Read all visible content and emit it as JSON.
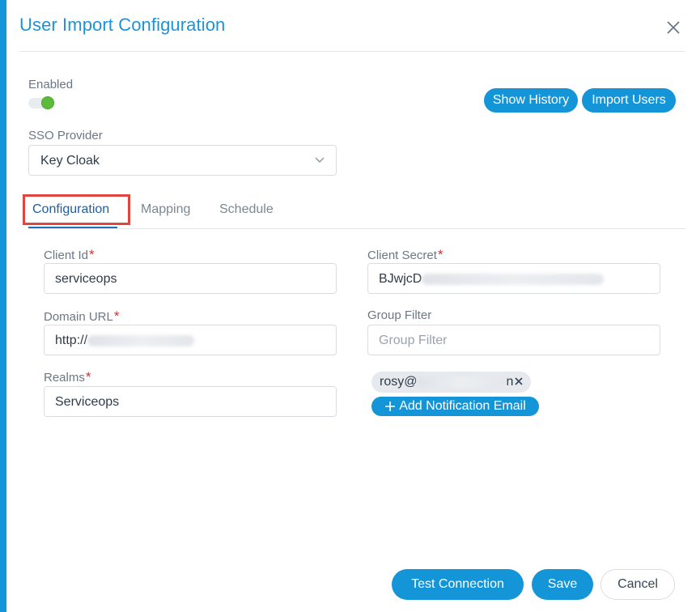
{
  "dialog": {
    "title": "User Import Configuration"
  },
  "enabled": {
    "label": "Enabled",
    "on": true
  },
  "header_actions": {
    "show_history": "Show History",
    "import_users": "Import Users"
  },
  "sso": {
    "label": "SSO Provider",
    "value": "Key Cloak"
  },
  "tabs": [
    {
      "label": "Configuration",
      "active": true
    },
    {
      "label": "Mapping",
      "active": false
    },
    {
      "label": "Schedule",
      "active": false
    }
  ],
  "form": {
    "client_id": {
      "label": "Client Id",
      "required": "*",
      "value": "serviceops"
    },
    "client_secret": {
      "label": "Client Secret",
      "required": "*",
      "value": "BJwjcD"
    },
    "domain_url": {
      "label": "Domain URL",
      "required": "*",
      "value": "http://"
    },
    "group_filter": {
      "label": "Group Filter",
      "placeholder": "Group Filter"
    },
    "realms": {
      "label": "Realms",
      "required": "*",
      "value": "Serviceops"
    }
  },
  "notification": {
    "email_prefix": "rosy@",
    "email_suffix": "n",
    "add_label": "Add Notification Email"
  },
  "footer": {
    "test_connection": "Test Connection",
    "save": "Save",
    "cancel": "Cancel"
  },
  "colors": {
    "accent": "#1395d8",
    "title": "#1e93d6",
    "toggle_on": "#5dba3b",
    "required": "#d32f2f",
    "tab_highlight": "#e0453f"
  },
  "icons": {
    "close": "close-icon",
    "chevron": "chevron-down-icon",
    "chip_remove": "remove-chip-icon",
    "add": "plus-icon"
  }
}
